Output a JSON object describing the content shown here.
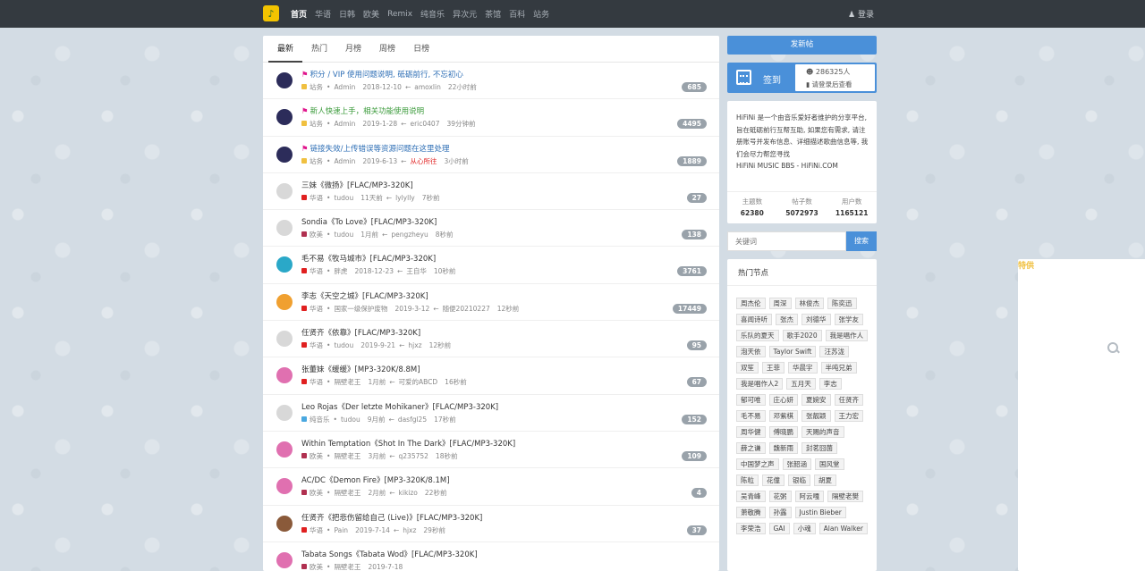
{
  "nav": {
    "items": [
      "首页",
      "华语",
      "日韩",
      "欧美",
      "Remix",
      "纯音乐",
      "异次元",
      "特供",
      "茶馆",
      "百科",
      "站务"
    ],
    "login": "登录"
  },
  "tabs": [
    "最新",
    "热门",
    "月榜",
    "周榜",
    "日榜"
  ],
  "threads": [
    {
      "title": "积分 / VIP 使用问题说明, 砥砺前行, 不忘初心",
      "style": "blue",
      "flag": true,
      "avatar": "#2c2c5a",
      "dot": "#f0c040",
      "forum": "站务",
      "author": "Admin",
      "date": "2018-12-10",
      "last": "amoxlin",
      "last_red": false,
      "time": "22小时前",
      "count": "685"
    },
    {
      "title": "新人快速上手，相关功能使用说明",
      "style": "green",
      "flag": true,
      "avatar": "#2c2c5a",
      "dot": "#f0c040",
      "forum": "站务",
      "author": "Admin",
      "date": "2019-1-28",
      "last": "eric0407",
      "last_red": false,
      "time": "39分钟前",
      "count": "4495"
    },
    {
      "title": "链接失效/上传错误等资源问题在这里处理",
      "style": "blue",
      "flag": true,
      "avatar": "#2c2c5a",
      "dot": "#f0c040",
      "forum": "站务",
      "author": "Admin",
      "date": "2019-6-13",
      "last": "从心所往",
      "last_red": true,
      "time": "3小时前",
      "count": "1889"
    },
    {
      "title": "三妹《微扬》[FLAC/MP3-320K]",
      "style": "black",
      "flag": false,
      "avatar": "#d8d8d8",
      "dot": "#e02020",
      "forum": "华语",
      "author": "tudou",
      "date": "11天前",
      "last": "lylylly",
      "last_red": false,
      "time": "7秒前",
      "count": "27"
    },
    {
      "title": "Sondia《To Love》[FLAC/MP3-320K]",
      "style": "black",
      "flag": false,
      "avatar": "#d8d8d8",
      "dot": "#b03050",
      "forum": "欧美",
      "author": "tudou",
      "date": "1月前",
      "last": "pengzheyu",
      "last_red": false,
      "time": "8秒前",
      "count": "138"
    },
    {
      "title": "毛不易《牧马城市》[FLAC/MP3-320K]",
      "style": "black",
      "flag": false,
      "avatar": "#2aa8c8",
      "dot": "#e02020",
      "forum": "华语",
      "author": "胖虎",
      "date": "2018-12-23",
      "last": "王自华",
      "last_red": false,
      "time": "10秒前",
      "count": "3761"
    },
    {
      "title": "李志《天空之城》[FLAC/MP3-320K]",
      "style": "black",
      "flag": false,
      "avatar": "#f0a030",
      "dot": "#e02020",
      "forum": "华语",
      "author": "国家一级保护废物",
      "date": "2019-3-12",
      "last": "随便20210227",
      "last_red": false,
      "time": "12秒前",
      "count": "17449"
    },
    {
      "title": "任贤齐《依靠》[FLAC/MP3-320K]",
      "style": "black",
      "flag": false,
      "avatar": "#d8d8d8",
      "dot": "#e02020",
      "forum": "华语",
      "author": "tudou",
      "date": "2019-9-21",
      "last": "hjxz",
      "last_red": false,
      "time": "12秒前",
      "count": "95"
    },
    {
      "title": "张董妹《缓缓》[MP3-320K/8.8M]",
      "style": "black",
      "flag": false,
      "avatar": "#e070b0",
      "dot": "#e02020",
      "forum": "华语",
      "author": "隔壁老王",
      "date": "1月前",
      "last": "可爱的ABCD",
      "last_red": false,
      "time": "16秒前",
      "count": "67"
    },
    {
      "title": "Leo Rojas《Der letzte Mohikaner》[FLAC/MP3-320K]",
      "style": "black",
      "flag": false,
      "avatar": "#d8d8d8",
      "dot": "#4aa8e0",
      "forum": "纯音乐",
      "author": "tudou",
      "date": "9月前",
      "last": "dasfgl25",
      "last_red": false,
      "time": "17秒前",
      "count": "152"
    },
    {
      "title": "Within Temptation《Shot In The Dark》[FLAC/MP3-320K]",
      "style": "black",
      "flag": false,
      "avatar": "#e070b0",
      "dot": "#b03050",
      "forum": "欧美",
      "author": "隔壁老王",
      "date": "3月前",
      "last": "q235752",
      "last_red": false,
      "time": "18秒前",
      "count": "109"
    },
    {
      "title": "AC/DC《Demon Fire》[MP3-320K/8.1M]",
      "style": "black",
      "flag": false,
      "avatar": "#e070b0",
      "dot": "#b03050",
      "forum": "欧美",
      "author": "隔壁老王",
      "date": "2月前",
      "last": "kikizo",
      "last_red": false,
      "time": "22秒前",
      "count": "4"
    },
    {
      "title": "任贤齐《把悲伤留给自己 (Live)》[FLAC/MP3-320K]",
      "style": "black",
      "flag": false,
      "avatar": "#8a5a3a",
      "dot": "#e02020",
      "forum": "华语",
      "author": "Pain",
      "date": "2019-7-14",
      "last": "hjxz",
      "last_red": false,
      "time": "29秒前",
      "count": "37"
    },
    {
      "title": "Tabata Songs《Tabata Wod》[FLAC/MP3-320K]",
      "style": "black",
      "flag": false,
      "avatar": "#e070b0",
      "dot": "#b03050",
      "forum": "欧美",
      "author": "隔壁老王",
      "date": "2019-7-18",
      "last": "",
      "last_red": false,
      "time": "",
      "count": ""
    }
  ],
  "sidebar": {
    "post_button": "发新帖",
    "signin_label": "签到",
    "signin_count": "286325人",
    "signin_hint": "请登录后查看",
    "intro": "HiFiNi 是一个由音乐爱好者维护的分享平台, 旨在砥砺前行互帮互助, 如果您有需求, 请注册账号并发布信息、详细描述歌曲信息等, 我们会尽力帮您寻找",
    "site_name": "HiFiNi MUSIC BBS - HiFiNi.COM",
    "stats": [
      {
        "label": "主题数",
        "value": "62380"
      },
      {
        "label": "帖子数",
        "value": "5072973"
      },
      {
        "label": "用户数",
        "value": "1165121"
      }
    ],
    "search_placeholder": "关键词",
    "search_button": "搜索",
    "hot_title": "热门节点",
    "tags": [
      "周杰伦",
      "周深",
      "林俊杰",
      "陈奕迅",
      "喜闻诗听",
      "张杰",
      "刘德华",
      "张学友",
      "乐队的夏天",
      "歌手2020",
      "我是唱作人",
      "泡天依",
      "Taylor Swift",
      "汪苏泷",
      "双笙",
      "王菲",
      "华晨宇",
      "半吨兄弟",
      "我是唱作人2",
      "五月天",
      "李志",
      "郁可唯",
      "庄心妍",
      "夏婉安",
      "任贤齐",
      "毛不易",
      "邓紫棋",
      "张靓颖",
      "王力宏",
      "周华健",
      "傅晓鹏",
      "天赐的声音",
      "薛之谦",
      "魏新雨",
      "封茗囧菌",
      "中国梦之声",
      "张韶涵",
      "国风堂",
      "陈粒",
      "花僮",
      "银临",
      "胡夏",
      "吴青峰",
      "花粥",
      "阿云嘎",
      "隔壁老樊",
      "萧敬腾",
      "孙露",
      "Justin Bieber",
      "李荣浩",
      "GAI",
      "小魂",
      "Alan Walker"
    ]
  }
}
